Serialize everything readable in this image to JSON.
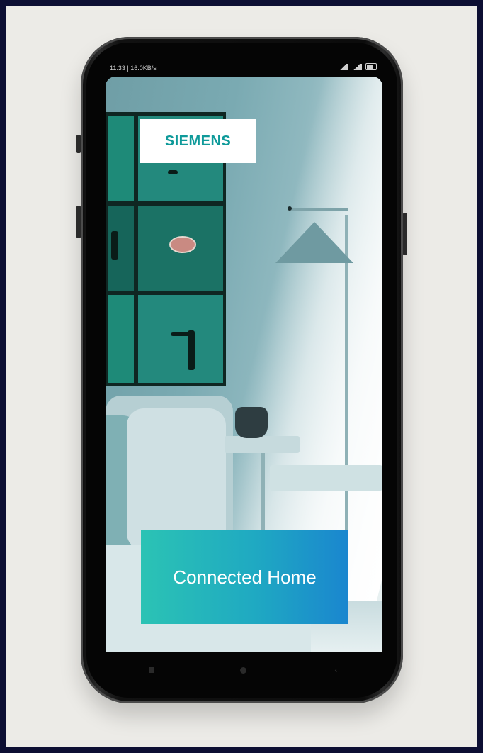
{
  "status_bar": {
    "time_speed": "11:33 | 16.0KB/s"
  },
  "brand": {
    "logo_text": "SIEMENS"
  },
  "banner": {
    "label": "Connected Home"
  },
  "nav": {
    "back_glyph": "‹"
  },
  "colors": {
    "logo": "#0f9a9a",
    "banner_start": "#2bc3b4",
    "banner_end": "#1a86cf",
    "page_background": "#ecebe7"
  },
  "icons": [
    "signal-icon",
    "wifi-icon",
    "battery-icon",
    "recents-icon",
    "home-icon",
    "back-icon"
  ]
}
